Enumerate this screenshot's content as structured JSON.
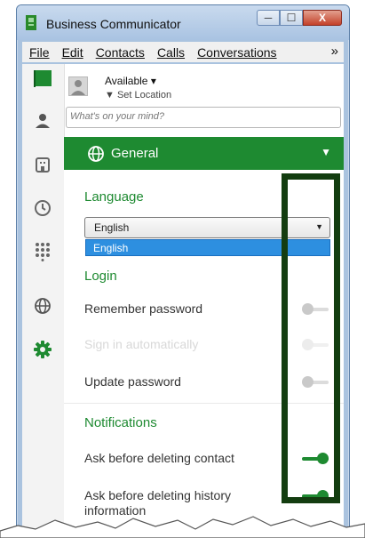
{
  "window": {
    "title": "Business Communicator",
    "minimize": "─",
    "maximize": "☐",
    "close": "X"
  },
  "menu": {
    "items": [
      "File",
      "Edit",
      "Contacts",
      "Calls",
      "Conversations"
    ],
    "more": "»"
  },
  "sidebar": {
    "icons": [
      "flag-icon",
      "contact-icon",
      "building-icon",
      "clock-icon",
      "dialpad-icon",
      "globe-icon",
      "gear-icon"
    ]
  },
  "status": {
    "availability": "Available ▾",
    "location": "▼ Set Location",
    "mind_placeholder": "What's on your mind?"
  },
  "general": {
    "title": "General",
    "caret": "▼"
  },
  "language": {
    "title": "Language",
    "selected": "English",
    "option": "English"
  },
  "login": {
    "title": "Login",
    "items": [
      {
        "label": "Remember password",
        "state": "off"
      },
      {
        "label": "Sign in automatically",
        "state": "disabled"
      },
      {
        "label": "Update password",
        "state": "off"
      }
    ]
  },
  "notifications": {
    "title": "Notifications",
    "items": [
      {
        "label": "Ask before deleting contact",
        "state": "on"
      },
      {
        "label": "Ask before deleting history information",
        "state": "on"
      }
    ]
  },
  "colors": {
    "accent": "#1e8a31",
    "highlight_border": "#133d10",
    "titlebar": "#aac3df"
  }
}
